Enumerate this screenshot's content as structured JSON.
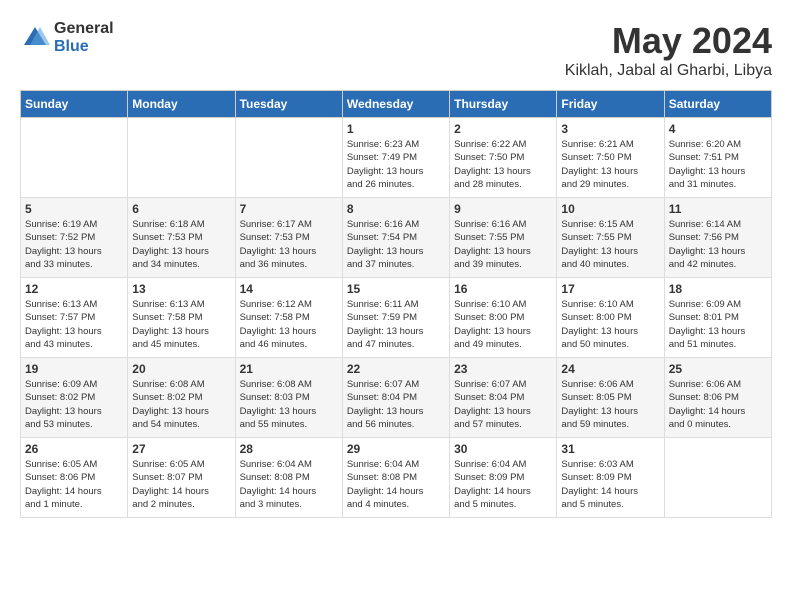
{
  "logo": {
    "general": "General",
    "blue": "Blue"
  },
  "header": {
    "month": "May 2024",
    "location": "Kiklah, Jabal al Gharbi, Libya"
  },
  "weekdays": [
    "Sunday",
    "Monday",
    "Tuesday",
    "Wednesday",
    "Thursday",
    "Friday",
    "Saturday"
  ],
  "weeks": [
    [
      {
        "day": "",
        "info": ""
      },
      {
        "day": "",
        "info": ""
      },
      {
        "day": "",
        "info": ""
      },
      {
        "day": "1",
        "info": "Sunrise: 6:23 AM\nSunset: 7:49 PM\nDaylight: 13 hours\nand 26 minutes."
      },
      {
        "day": "2",
        "info": "Sunrise: 6:22 AM\nSunset: 7:50 PM\nDaylight: 13 hours\nand 28 minutes."
      },
      {
        "day": "3",
        "info": "Sunrise: 6:21 AM\nSunset: 7:50 PM\nDaylight: 13 hours\nand 29 minutes."
      },
      {
        "day": "4",
        "info": "Sunrise: 6:20 AM\nSunset: 7:51 PM\nDaylight: 13 hours\nand 31 minutes."
      }
    ],
    [
      {
        "day": "5",
        "info": "Sunrise: 6:19 AM\nSunset: 7:52 PM\nDaylight: 13 hours\nand 33 minutes."
      },
      {
        "day": "6",
        "info": "Sunrise: 6:18 AM\nSunset: 7:53 PM\nDaylight: 13 hours\nand 34 minutes."
      },
      {
        "day": "7",
        "info": "Sunrise: 6:17 AM\nSunset: 7:53 PM\nDaylight: 13 hours\nand 36 minutes."
      },
      {
        "day": "8",
        "info": "Sunrise: 6:16 AM\nSunset: 7:54 PM\nDaylight: 13 hours\nand 37 minutes."
      },
      {
        "day": "9",
        "info": "Sunrise: 6:16 AM\nSunset: 7:55 PM\nDaylight: 13 hours\nand 39 minutes."
      },
      {
        "day": "10",
        "info": "Sunrise: 6:15 AM\nSunset: 7:55 PM\nDaylight: 13 hours\nand 40 minutes."
      },
      {
        "day": "11",
        "info": "Sunrise: 6:14 AM\nSunset: 7:56 PM\nDaylight: 13 hours\nand 42 minutes."
      }
    ],
    [
      {
        "day": "12",
        "info": "Sunrise: 6:13 AM\nSunset: 7:57 PM\nDaylight: 13 hours\nand 43 minutes."
      },
      {
        "day": "13",
        "info": "Sunrise: 6:13 AM\nSunset: 7:58 PM\nDaylight: 13 hours\nand 45 minutes."
      },
      {
        "day": "14",
        "info": "Sunrise: 6:12 AM\nSunset: 7:58 PM\nDaylight: 13 hours\nand 46 minutes."
      },
      {
        "day": "15",
        "info": "Sunrise: 6:11 AM\nSunset: 7:59 PM\nDaylight: 13 hours\nand 47 minutes."
      },
      {
        "day": "16",
        "info": "Sunrise: 6:10 AM\nSunset: 8:00 PM\nDaylight: 13 hours\nand 49 minutes."
      },
      {
        "day": "17",
        "info": "Sunrise: 6:10 AM\nSunset: 8:00 PM\nDaylight: 13 hours\nand 50 minutes."
      },
      {
        "day": "18",
        "info": "Sunrise: 6:09 AM\nSunset: 8:01 PM\nDaylight: 13 hours\nand 51 minutes."
      }
    ],
    [
      {
        "day": "19",
        "info": "Sunrise: 6:09 AM\nSunset: 8:02 PM\nDaylight: 13 hours\nand 53 minutes."
      },
      {
        "day": "20",
        "info": "Sunrise: 6:08 AM\nSunset: 8:02 PM\nDaylight: 13 hours\nand 54 minutes."
      },
      {
        "day": "21",
        "info": "Sunrise: 6:08 AM\nSunset: 8:03 PM\nDaylight: 13 hours\nand 55 minutes."
      },
      {
        "day": "22",
        "info": "Sunrise: 6:07 AM\nSunset: 8:04 PM\nDaylight: 13 hours\nand 56 minutes."
      },
      {
        "day": "23",
        "info": "Sunrise: 6:07 AM\nSunset: 8:04 PM\nDaylight: 13 hours\nand 57 minutes."
      },
      {
        "day": "24",
        "info": "Sunrise: 6:06 AM\nSunset: 8:05 PM\nDaylight: 13 hours\nand 59 minutes."
      },
      {
        "day": "25",
        "info": "Sunrise: 6:06 AM\nSunset: 8:06 PM\nDaylight: 14 hours\nand 0 minutes."
      }
    ],
    [
      {
        "day": "26",
        "info": "Sunrise: 6:05 AM\nSunset: 8:06 PM\nDaylight: 14 hours\nand 1 minute."
      },
      {
        "day": "27",
        "info": "Sunrise: 6:05 AM\nSunset: 8:07 PM\nDaylight: 14 hours\nand 2 minutes."
      },
      {
        "day": "28",
        "info": "Sunrise: 6:04 AM\nSunset: 8:08 PM\nDaylight: 14 hours\nand 3 minutes."
      },
      {
        "day": "29",
        "info": "Sunrise: 6:04 AM\nSunset: 8:08 PM\nDaylight: 14 hours\nand 4 minutes."
      },
      {
        "day": "30",
        "info": "Sunrise: 6:04 AM\nSunset: 8:09 PM\nDaylight: 14 hours\nand 5 minutes."
      },
      {
        "day": "31",
        "info": "Sunrise: 6:03 AM\nSunset: 8:09 PM\nDaylight: 14 hours\nand 5 minutes."
      },
      {
        "day": "",
        "info": ""
      }
    ]
  ]
}
